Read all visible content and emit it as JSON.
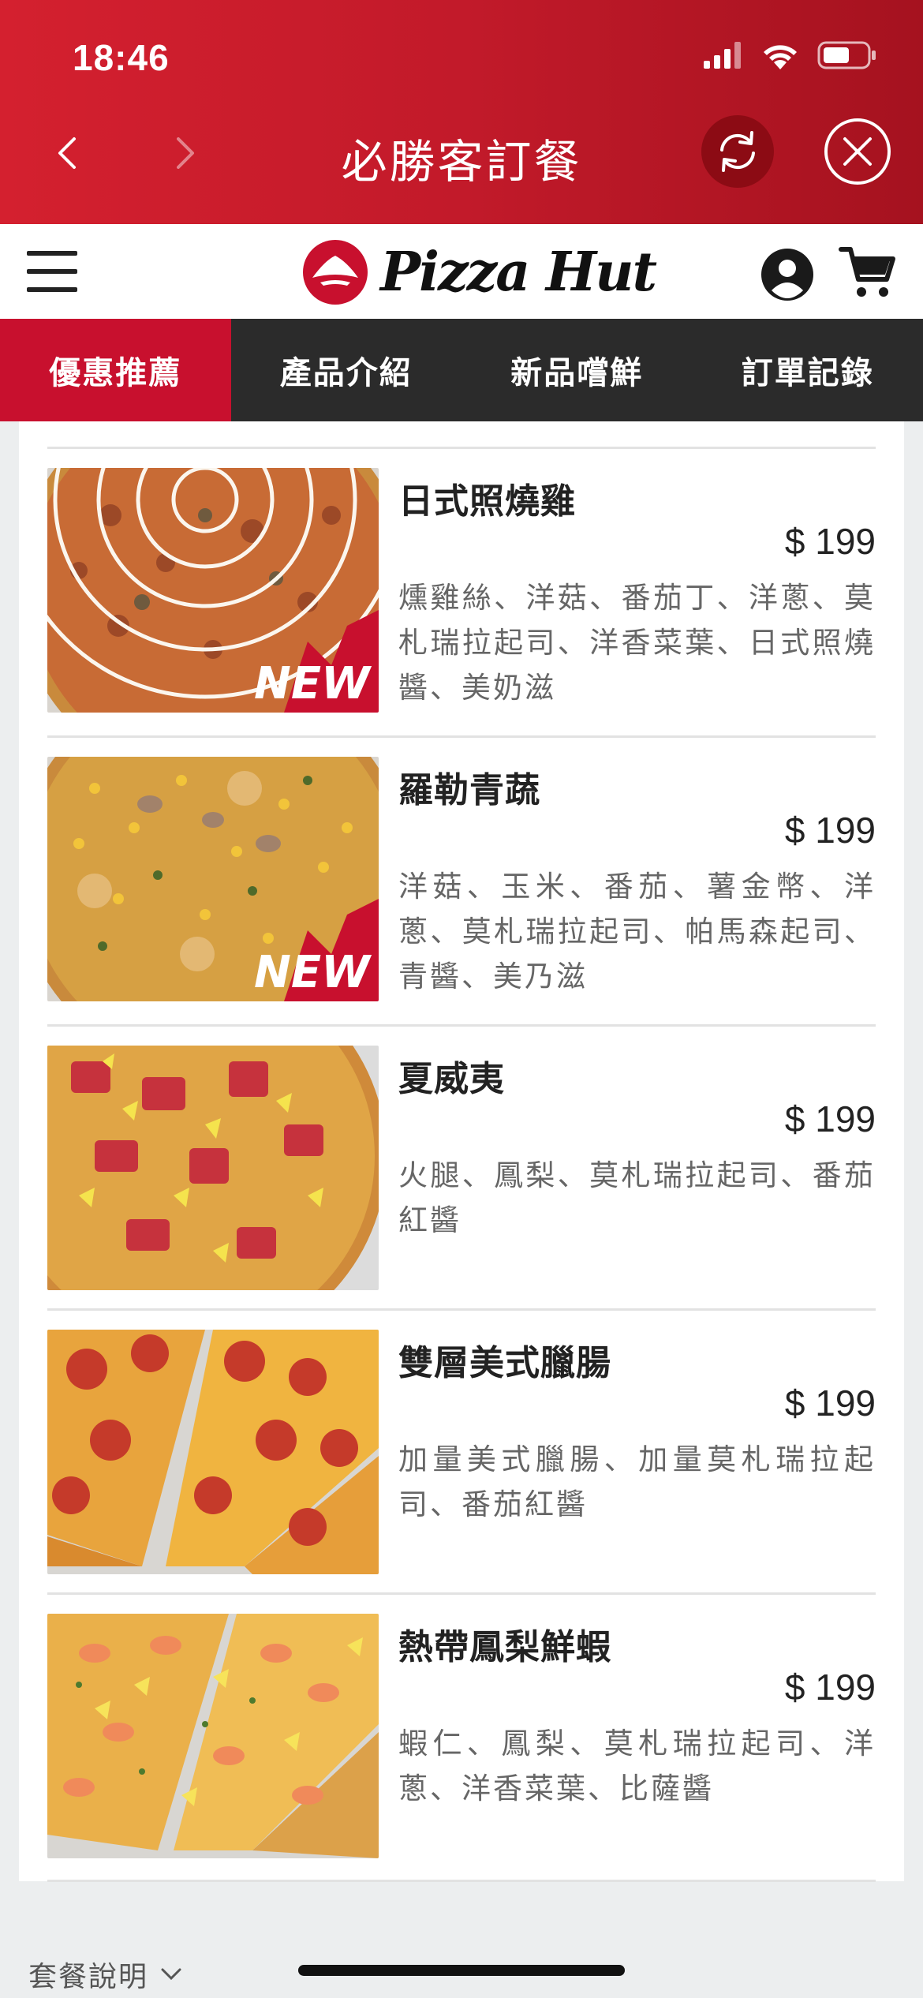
{
  "status_bar": {
    "time": "18:46"
  },
  "header": {
    "title": "必勝客訂餐"
  },
  "brand": {
    "logo_text": "Pizza Hut"
  },
  "tabs": [
    {
      "label": "優惠推薦",
      "active": true
    },
    {
      "label": "產品介紹",
      "active": false
    },
    {
      "label": "新品嚐鮮",
      "active": false
    },
    {
      "label": "訂單記錄",
      "active": false
    }
  ],
  "items": [
    {
      "name": "日式照燒雞",
      "price": "$ 199",
      "description": "燻雞絲、洋菇、番茄丁、洋蔥、莫札瑞拉起司、洋香菜葉、日式照燒醬、美奶滋",
      "badge": "NEW"
    },
    {
      "name": "羅勒青蔬",
      "price": "$ 199",
      "description": "洋菇、玉米、番茄、薯金幣、洋蔥、莫札瑞拉起司、帕馬森起司、青醬、美乃滋",
      "badge": "NEW"
    },
    {
      "name": "夏威夷",
      "price": "$ 199",
      "description": "火腿、鳳梨、莫札瑞拉起司、番茄紅醬"
    },
    {
      "name": "雙層美式臘腸",
      "price": "$ 199",
      "description": "加量美式臘腸、加量莫札瑞拉起司、番茄紅醬"
    },
    {
      "name": "熱帶鳳梨鮮蝦",
      "price": "$ 199",
      "description": "蝦仁、鳳梨、莫札瑞拉起司、洋蔥、洋香菜葉、比薩醬"
    }
  ],
  "footer": {
    "note": "套餐說明"
  },
  "colors": {
    "brand_red": "#c8102e",
    "tab_bg": "#2b2b2b",
    "header_red": "#d4202f"
  }
}
